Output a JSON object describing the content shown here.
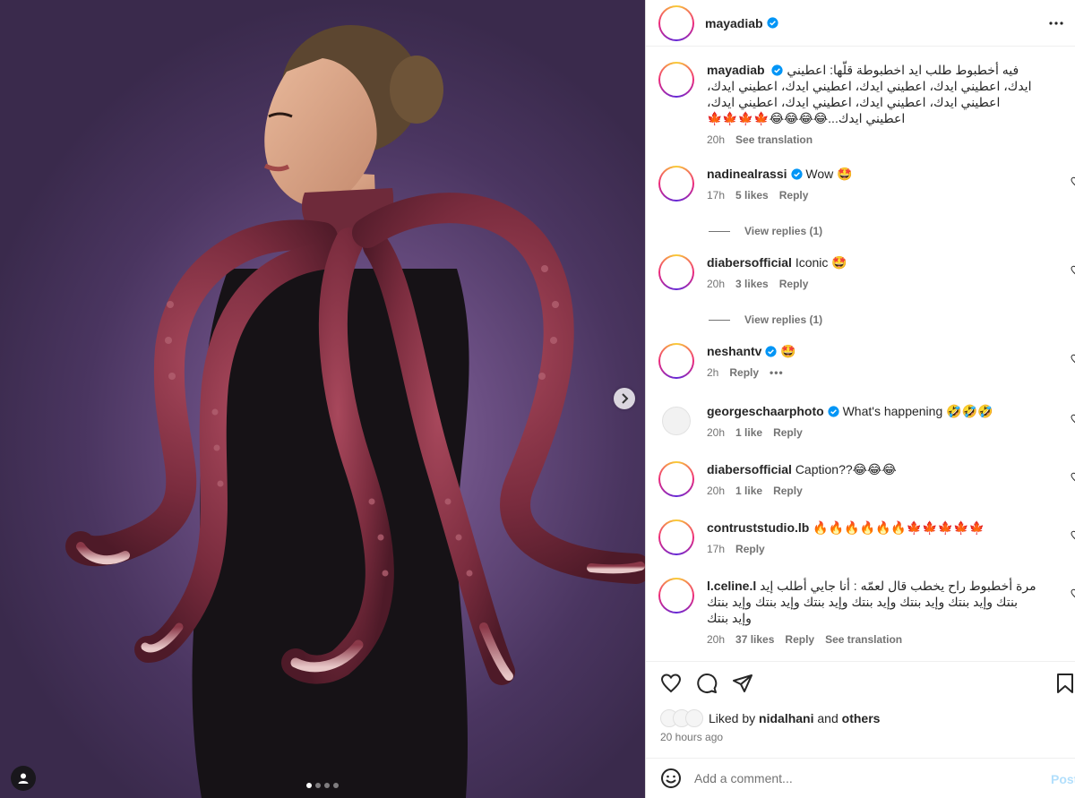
{
  "post": {
    "username": "mayadiab",
    "caption": "فيه أخطبوط طلب ايد اخطبوطة قلّها: اعطيني ايدك، اعطيني ايدك، اعطيني ايدك، اعطيني ايدك، اعطيني ايدك، اعطيني ايدك، اعطيني ايدك، اعطيني ايدك، اعطيني ايدك، اعطيني ايدك...😂😂😂😂🍁🍁🍁🍁",
    "caption_time": "20h",
    "see_translation": "See translation",
    "image_alt": "Woman wearing octopus tentacle costume"
  },
  "comments": [
    {
      "user": "nadinealrassi",
      "verified": true,
      "text": "Wow 🤩",
      "time": "17h",
      "likes": "5 likes",
      "reply": "Reply",
      "view_replies": "View replies (1)"
    },
    {
      "user": "diabersofficial",
      "verified": false,
      "text": "Iconic 🤩",
      "time": "20h",
      "likes": "3 likes",
      "reply": "Reply",
      "view_replies": "View replies (1)"
    },
    {
      "user": "neshantv",
      "verified": true,
      "text": "🤩",
      "time": "2h",
      "reply": "Reply",
      "more": "•••"
    },
    {
      "user": "georgeschaarphoto",
      "verified": true,
      "text": "What's happening 🤣🤣🤣",
      "time": "20h",
      "likes": "1 like",
      "reply": "Reply"
    },
    {
      "user": "diabersofficial",
      "verified": false,
      "text": "Caption??😂😂😂",
      "time": "20h",
      "likes": "1 like",
      "reply": "Reply"
    },
    {
      "user": "contruststudio.lb",
      "verified": false,
      "text": "🔥🔥🔥🔥🔥🔥🍁🍁🍁🍁🍁",
      "time": "17h",
      "reply": "Reply"
    },
    {
      "user": "l.celine.l",
      "verified": false,
      "text": "مرة أخطبوط راح يخطب قال لعمّه : أنا جايي أطلب إيد بنتك وإيد بنتك وإيد بنتك وإيد بنتك وإيد بنتك وإيد بنتك وإيد بنتك وإيد بنتك",
      "time": "20h",
      "likes": "37 likes",
      "reply": "Reply",
      "see_translation": "See translation"
    }
  ],
  "liked_by": {
    "prefix": "Liked by",
    "user": "nidalhani",
    "and": "and",
    "others": "others"
  },
  "time_ago": "20 hours ago",
  "add_comment": {
    "placeholder": "Add a comment...",
    "post_label": "Post"
  },
  "carousel": {
    "count": 4,
    "active_index": 0
  },
  "colors": {
    "verified": "#0095f6",
    "gradient": [
      "#f9ce34",
      "#ee2a7b",
      "#6228d7"
    ],
    "post_button": "#b2dffc"
  }
}
